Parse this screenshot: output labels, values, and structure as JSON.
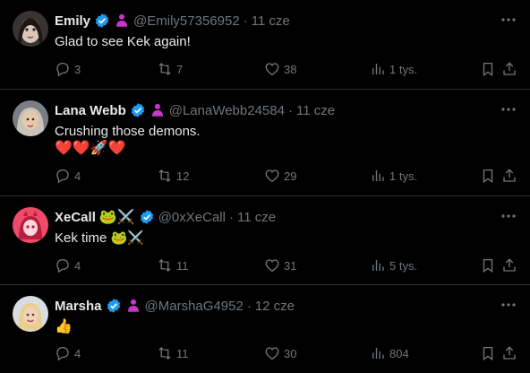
{
  "tweets": [
    {
      "name": "Emily",
      "handle": "@Emily57356952",
      "time": "11 cze",
      "text": "Glad to see Kek again!",
      "extra": "",
      "name_emoji": "",
      "replies": "3",
      "retweets": "7",
      "likes": "38",
      "views": "1 tys."
    },
    {
      "name": "Lana Webb",
      "handle": "@LanaWebb24584",
      "time": "11 cze",
      "text": "Crushing those demons.",
      "extra": "❤️❤️🚀❤️",
      "name_emoji": "",
      "replies": "4",
      "retweets": "12",
      "likes": "29",
      "views": "1 tys."
    },
    {
      "name": "XeCall",
      "handle": "@0xXeCall",
      "time": "11 cze",
      "text": "Kek time 🐸⚔️",
      "extra": "",
      "name_emoji": "🐸⚔️",
      "replies": "4",
      "retweets": "11",
      "likes": "31",
      "views": "5 tys."
    },
    {
      "name": "Marsha",
      "handle": "@MarshaG4952",
      "time": "12 cze",
      "text": "👍",
      "extra": "",
      "name_emoji": "",
      "replies": "4",
      "retweets": "11",
      "likes": "30",
      "views": "804"
    }
  ],
  "icons": {
    "verified": "verified-badge-icon",
    "affiliate": "affiliate-person-icon",
    "reply": "reply-icon",
    "retweet": "retweet-icon",
    "like": "heart-icon",
    "views": "views-chart-icon",
    "bookmark": "bookmark-icon",
    "share": "share-icon",
    "more": "more-options-icon"
  },
  "colors": {
    "background": "#000000",
    "text": "#e7e9ea",
    "muted": "#71767b",
    "verified": "#1d9bf0",
    "affiliate": "#c936cc",
    "divider": "#2f3336"
  }
}
